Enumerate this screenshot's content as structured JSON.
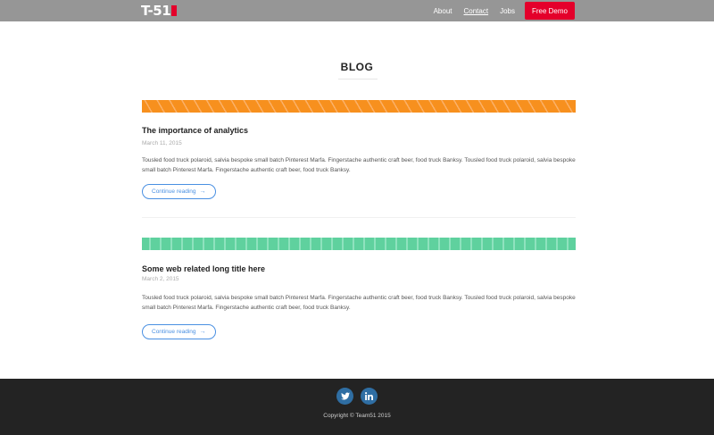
{
  "nav": {
    "logo_text": "T-51",
    "links": [
      {
        "label": "About"
      },
      {
        "label": "Contact"
      },
      {
        "label": "Jobs"
      }
    ],
    "demo_label": "Free Demo",
    "active_link": "Contact"
  },
  "page": {
    "title": "BLOG"
  },
  "posts": [
    {
      "title": "The importance of analytics",
      "date": "March 11, 2015",
      "body": "Tousled food truck polaroid, salvia bespoke small batch Pinterest Marfa. Fingerstache authentic craft beer, food truck Banksy. Tousled food truck polaroid, salvia bespoke small batch Pinterest Marfa. Fingerstache authentic craft beer, food truck Banksy.",
      "read_more": "Continue reading",
      "banner_color": "#f7901e"
    },
    {
      "title": "Some web related long title here",
      "date": "March 2, 2015",
      "body": "Tousled food truck polaroid, salvia bespoke small batch Pinterest Marfa. Fingerstache authentic craft beer, food truck Banksy. Tousled food truck polaroid, salvia bespoke small batch Pinterest Marfa. Fingerstache authentic craft beer, food truck Banksy.",
      "read_more": "Continue reading",
      "banner_color": "#5fd19e"
    }
  ],
  "footer": {
    "social": [
      {
        "icon": "twitter-icon"
      },
      {
        "icon": "linkedin-icon"
      }
    ],
    "copyright": "Copyright © Team51 2015"
  },
  "colors": {
    "accent": "#e4002b",
    "link": "#4a90e2",
    "nav_bg": "#969696",
    "footer_bg": "#232323"
  }
}
